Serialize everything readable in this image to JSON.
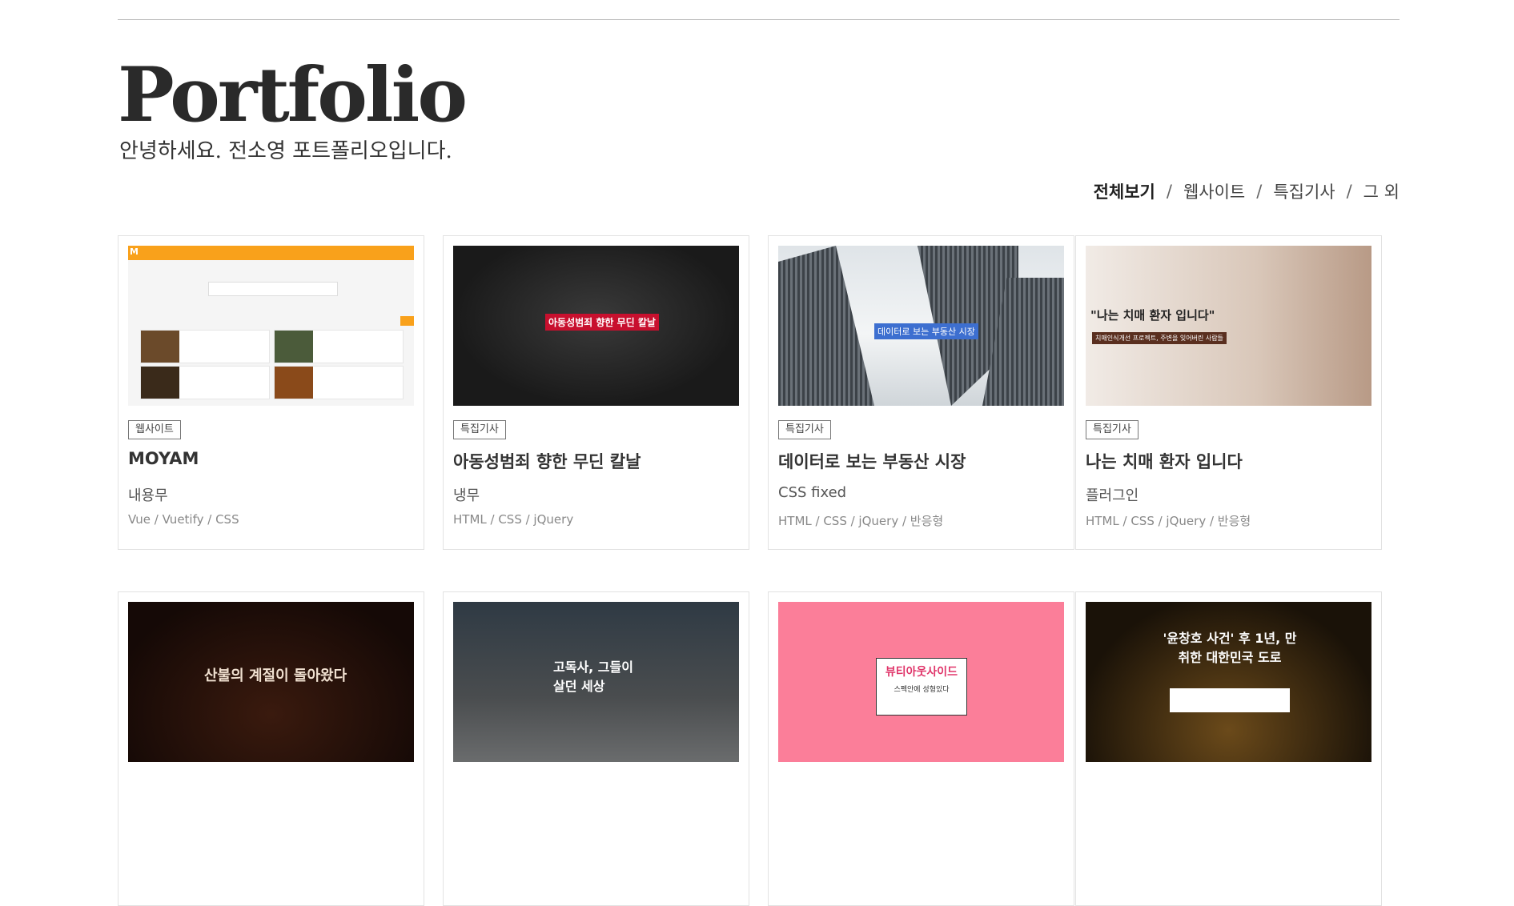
{
  "header": {
    "title": "Portfolio",
    "subtitle": "안녕하세요. 전소영 포트폴리오입니다."
  },
  "filters": [
    {
      "label": "전체보기",
      "active": true
    },
    {
      "label": "웹사이트",
      "active": false
    },
    {
      "label": "특집기사",
      "active": false
    },
    {
      "label": "그 외",
      "active": false
    }
  ],
  "filter_separator": "/",
  "cards": [
    {
      "tag": "웹사이트",
      "name": "MOYAM",
      "desc": "내용무",
      "tech": "Vue / Vuetify / CSS"
    },
    {
      "tag": "특집기사",
      "name": "아동성범죄 향한 무딘 칼날",
      "desc": "냉무",
      "tech": "HTML / CSS / jQuery"
    },
    {
      "tag": "특집기사",
      "name": "데이터로 보는 부동산 시장",
      "desc": "CSS fixed",
      "tech": "HTML / CSS / jQuery / 반응형"
    },
    {
      "tag": "특집기사",
      "name": "나는 치매 환자 입니다",
      "desc": "플러그인",
      "tech": "HTML / CSS / jQuery / 반응형"
    }
  ],
  "thumbs": {
    "moyam_logo": "M",
    "knife_label": "아동성범죄 향한 무딘 칼날",
    "building_label": "데이터로 보는 부동산 시장",
    "dementia_quote": "\"나는 치매 환자 입니다\"",
    "dementia_label": "치매인식개선 프로젝트, 주변을 잊어버린 사람들",
    "fire_text": "산불의 계절이 돌아왔다",
    "room_text": "고독사, 그들이 살던 세상",
    "pink_text": "뷰티아웃사이드",
    "pink_sub": "스펙안에 성형있다",
    "city_text": "'윤창호 사건' 후 1년, 만취한 대한민국 도로"
  }
}
